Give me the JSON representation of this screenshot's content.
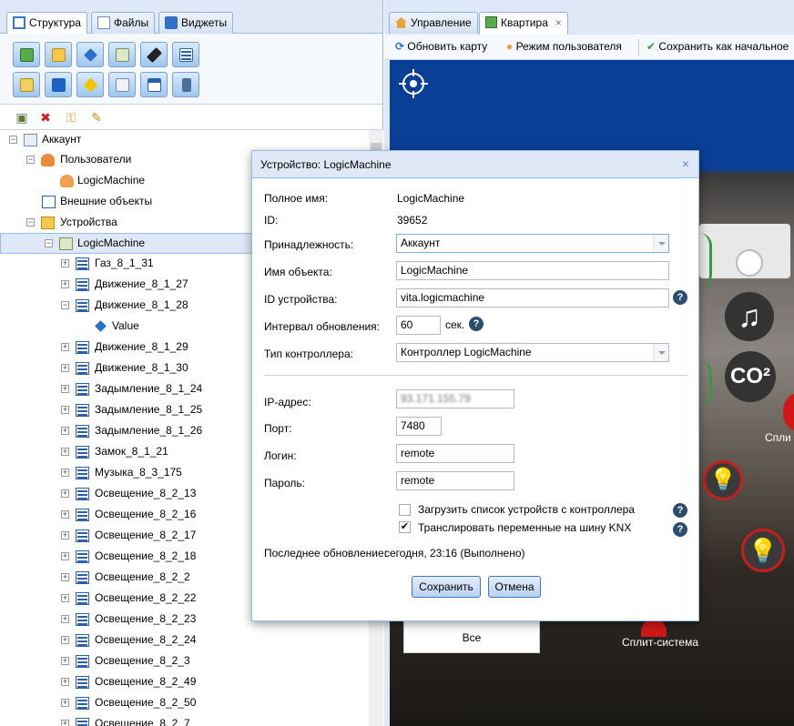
{
  "left_panel": {
    "tabs": [
      {
        "label": "Структура"
      },
      {
        "label": "Файлы"
      },
      {
        "label": "Виджеты"
      }
    ],
    "tree": {
      "account": "Аккаунт",
      "users": "Пользователи",
      "user_logicmachine": "LogicMachine",
      "external": "Внешние объекты",
      "devices": "Устройства",
      "device": "LogicMachine",
      "items": [
        "Газ_8_1_31",
        "Движение_8_1_27",
        "Движение_8_1_28",
        "Value",
        "Движение_8_1_29",
        "Движение_8_1_30",
        "Задымление_8_1_24",
        "Задымление_8_1_25",
        "Задымление_8_1_26",
        "Замок_8_1_21",
        "Музыка_8_3_175",
        "Освещение_8_2_13",
        "Освещение_8_2_16",
        "Освещение_8_2_17",
        "Освещение_8_2_18",
        "Освещение_8_2_2",
        "Освещение_8_2_22",
        "Освещение_8_2_23",
        "Освещение_8_2_24",
        "Освещение_8_2_3",
        "Освещение_8_2_49",
        "Освещение_8_2_50",
        "Освещение_8_2_7"
      ]
    }
  },
  "right_panel": {
    "tabs": [
      {
        "label": "Управление"
      },
      {
        "label": "Квартира"
      }
    ],
    "toolbar": {
      "refresh": "Обновить карту",
      "user_mode": "Режим пользователя",
      "save_home": "Сохранить как начальное"
    },
    "map_labels": {
      "co2": "CO²",
      "split1": "Спли",
      "split2": "Сплит-система",
      "all": "Все"
    }
  },
  "dialog": {
    "title": "Устройство: LogicMachine",
    "close": "×",
    "fields": {
      "full_name_label": "Полное имя:",
      "full_name": "LogicMachine",
      "id_label": "ID:",
      "id": "39652",
      "owner_label": "Принадлежность:",
      "owner": "Аккаунт",
      "object_name_label": "Имя объекта:",
      "object_name": "LogicMachine",
      "device_id_label": "ID устройства:",
      "device_id": "vita.logicmachine",
      "interval_label": "Интервал обновления:",
      "interval": "60",
      "interval_unit": "сек.",
      "controller_type_label": "Тип контроллера:",
      "controller_type": "Контроллер LogicMachine",
      "ip_label": "IP-адрес:",
      "ip": "93.171.155.79",
      "port_label": "Порт:",
      "port": "7480",
      "login_label": "Логин:",
      "login": "remote",
      "password_label": "Пароль:",
      "password": "remote",
      "load_devices": "Загрузить список устройств с контроллера",
      "broadcast": "Транслировать переменные на шину KNX",
      "last_update_label": "Последнее обновление:",
      "last_update": "сегодня, 23:16 (Выполнено)"
    },
    "buttons": {
      "save": "Сохранить",
      "cancel": "Отмена"
    },
    "help": "?"
  },
  "colors": {
    "panel_bg": "#dfe8f6",
    "border": "#99bbe8",
    "map_blue": "#0a3f96"
  }
}
